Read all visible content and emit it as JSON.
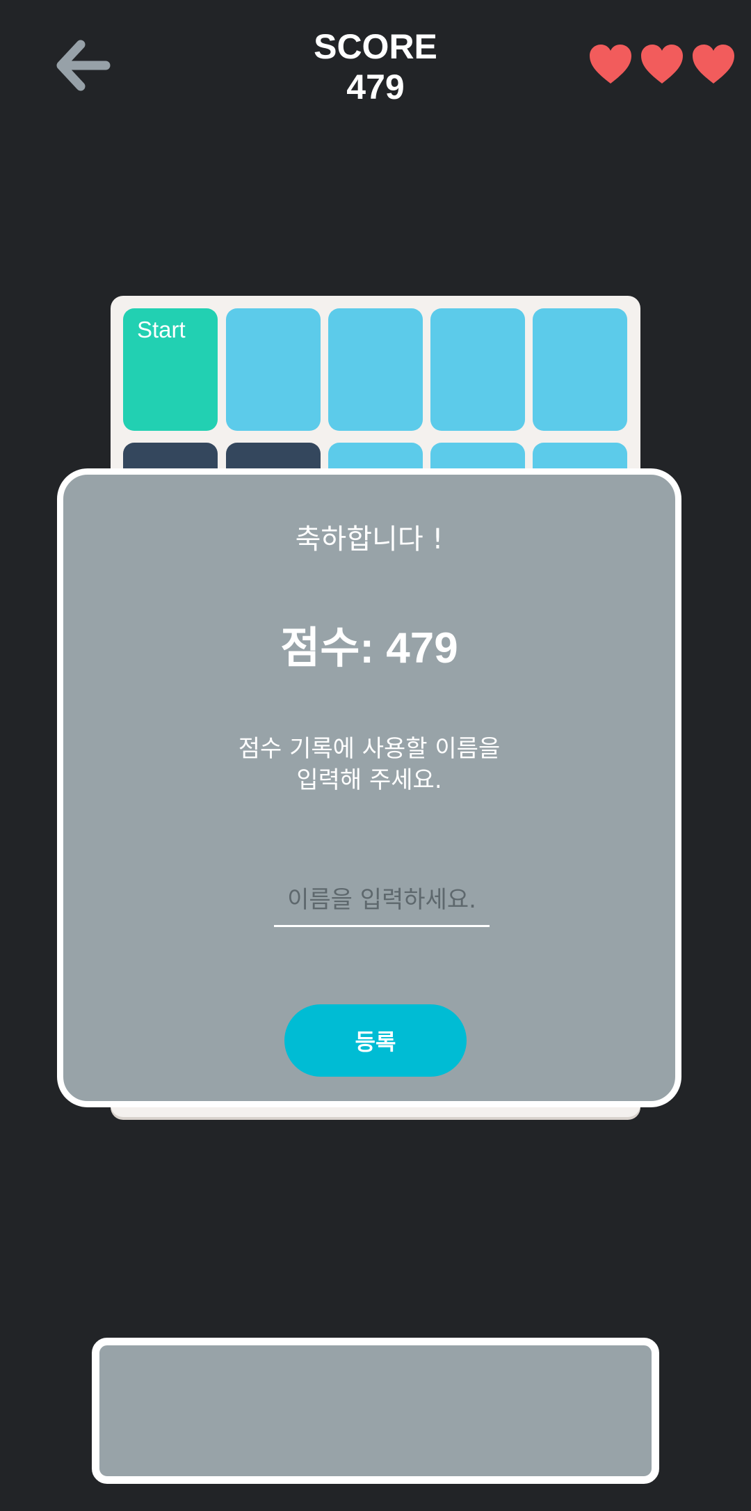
{
  "header": {
    "back_icon": "arrow-left-icon",
    "score_label": "SCORE",
    "score_value": "479",
    "lives": {
      "count": 3,
      "icon": "heart-icon",
      "color": "#f25c5c"
    }
  },
  "board": {
    "start_label": "Start",
    "colors": {
      "start": "#22d0b2",
      "open": "#5ccbea",
      "wall": "#34475d",
      "frame": "#f4f1ee"
    }
  },
  "modal": {
    "title": "축하합니다 !",
    "score_text": "점수: 479",
    "instruction_line1": "점수 기록에 사용할 이름을",
    "instruction_line2": "입력해 주세요.",
    "name_input": {
      "placeholder": "이름을 입력하세요.",
      "value": ""
    },
    "register_label": "등록",
    "colors": {
      "background": "#98a3a8",
      "button": "#00bcd4"
    }
  },
  "colors": {
    "app_background": "#222427"
  }
}
